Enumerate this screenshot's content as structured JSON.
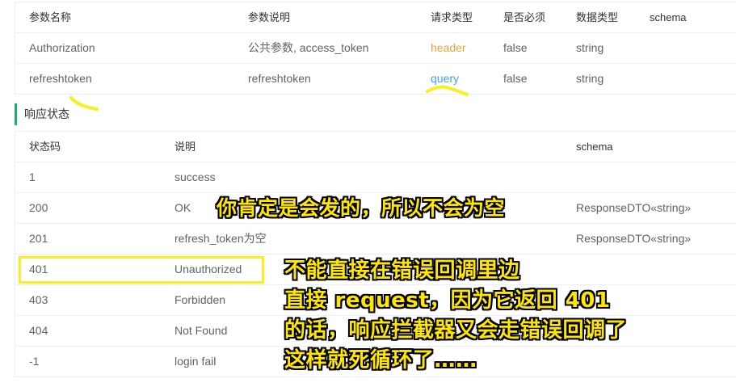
{
  "params_table": {
    "headers": [
      "参数名称",
      "参数说明",
      "请求类型",
      "是否必须",
      "数据类型",
      "schema"
    ],
    "rows": [
      [
        "Authorization",
        "公共参数, access_token",
        "header",
        "false",
        "string",
        ""
      ],
      [
        "refreshtoken",
        "refreshtoken",
        "query",
        "false",
        "string",
        ""
      ]
    ]
  },
  "response_section": {
    "title": "响应状态"
  },
  "response_table": {
    "headers": [
      "状态码",
      "说明",
      "schema"
    ],
    "rows": [
      [
        "1",
        "success",
        ""
      ],
      [
        "200",
        "OK",
        "ResponseDTO«string»"
      ],
      [
        "201",
        "refresh_token为空",
        "ResponseDTO«string»"
      ],
      [
        "401",
        "Unauthorized",
        ""
      ],
      [
        "403",
        "Forbidden",
        ""
      ],
      [
        "404",
        "Not Found",
        ""
      ],
      [
        "-1",
        "login fail",
        ""
      ]
    ]
  },
  "annotations": {
    "note1": "你肯定是会发的，所以不会为空",
    "note2_lines": [
      "不能直接在错误回调里边",
      "直接 request，因为它返回 401",
      "的话，响应拦截器又会走错误回调了",
      "这样就死循环了……"
    ]
  },
  "colors": {
    "header_type": "#e6a23c",
    "query_type": "#409eff",
    "section_bar": "#1aad6f",
    "highlight": "#f7ef1f"
  }
}
